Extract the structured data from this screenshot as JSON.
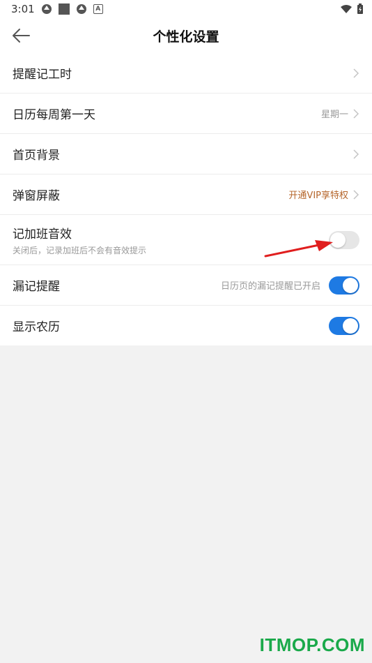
{
  "status_bar": {
    "time": "3:01"
  },
  "header": {
    "title": "个性化设置"
  },
  "settings": [
    {
      "label": "提醒记工时",
      "value": "",
      "control": "chevron"
    },
    {
      "label": "日历每周第一天",
      "value": "星期一",
      "control": "chevron"
    },
    {
      "label": "首页背景",
      "value": "",
      "control": "chevron"
    },
    {
      "label": "弹窗屏蔽",
      "value": "开通VIP享特权",
      "control": "chevron"
    },
    {
      "label": "记加班音效",
      "sub": "关闭后，记录加班后不会有音效提示",
      "control": "toggle",
      "on": false
    },
    {
      "label": "漏记提醒",
      "value": "日历页的漏记提醒已开启",
      "control": "toggle",
      "on": true
    },
    {
      "label": "显示农历",
      "value": "",
      "control": "toggle",
      "on": true
    }
  ],
  "colors": {
    "accent": "#1e7ae3",
    "vip": "#b5652a",
    "annotation": "#e01e1e",
    "watermark": "#1aa94a"
  },
  "watermark": "ITMOP.COM"
}
